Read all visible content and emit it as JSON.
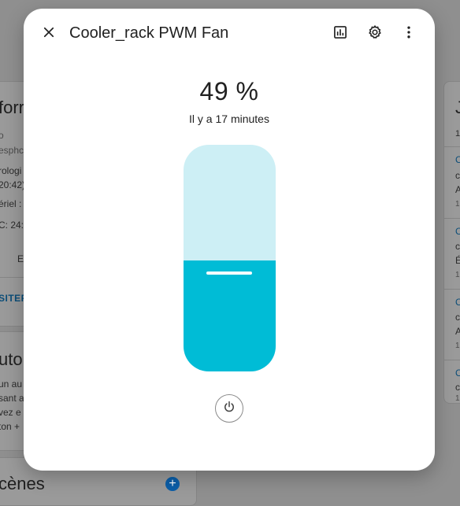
{
  "dialog": {
    "title": "Cooler_rack PWM Fan",
    "value_text": "49 %",
    "last_changed": "Il y a 17 minutes",
    "fan_speed_percent": 49,
    "accent_color": "#00bcd6",
    "track_color": "#cdeff5",
    "icons": {
      "close": "close-icon",
      "history": "chart-icon",
      "settings": "gear-icon",
      "menu": "more-vert-icon",
      "power": "power-icon"
    }
  },
  "background": {
    "left_card": {
      "heading_fragment": "forr",
      "lines": [
        "o",
        "esphc",
        "rologi",
        "20:42)",
        "ériel :",
        "C: 24:",
        "E"
      ],
      "link": "SITEF"
    },
    "auto_card": {
      "heading_fragment": "utor",
      "lines": [
        "un au",
        "sant a",
        "vez e",
        "ton +"
      ]
    },
    "scenes_heading": "cènes",
    "right_card": {
      "items": [
        "C",
        "c",
        "A",
        "1",
        "C",
        "c",
        "É",
        "1",
        "C",
        "c",
        "A",
        "1",
        "C",
        "c",
        "1"
      ]
    }
  }
}
